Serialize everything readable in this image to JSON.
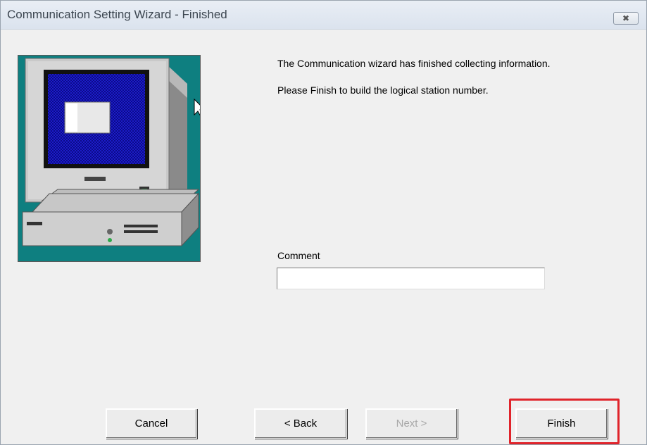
{
  "window": {
    "title": "Communication Setting Wizard - Finished",
    "close_icon": "close-icon"
  },
  "illustration": {
    "icon": "computer-icon"
  },
  "message": {
    "line1": "The Communication wizard has finished collecting information.",
    "line2": "Please Finish to build the logical station number."
  },
  "comment": {
    "label": "Comment",
    "value": ""
  },
  "buttons": {
    "cancel": "Cancel",
    "back": "< Back",
    "next": "Next >",
    "finish": "Finish"
  },
  "colors": {
    "highlight": "#e0242b",
    "illustration_bg": "#0e7f80",
    "disabled_text": "#a8a8a8"
  }
}
